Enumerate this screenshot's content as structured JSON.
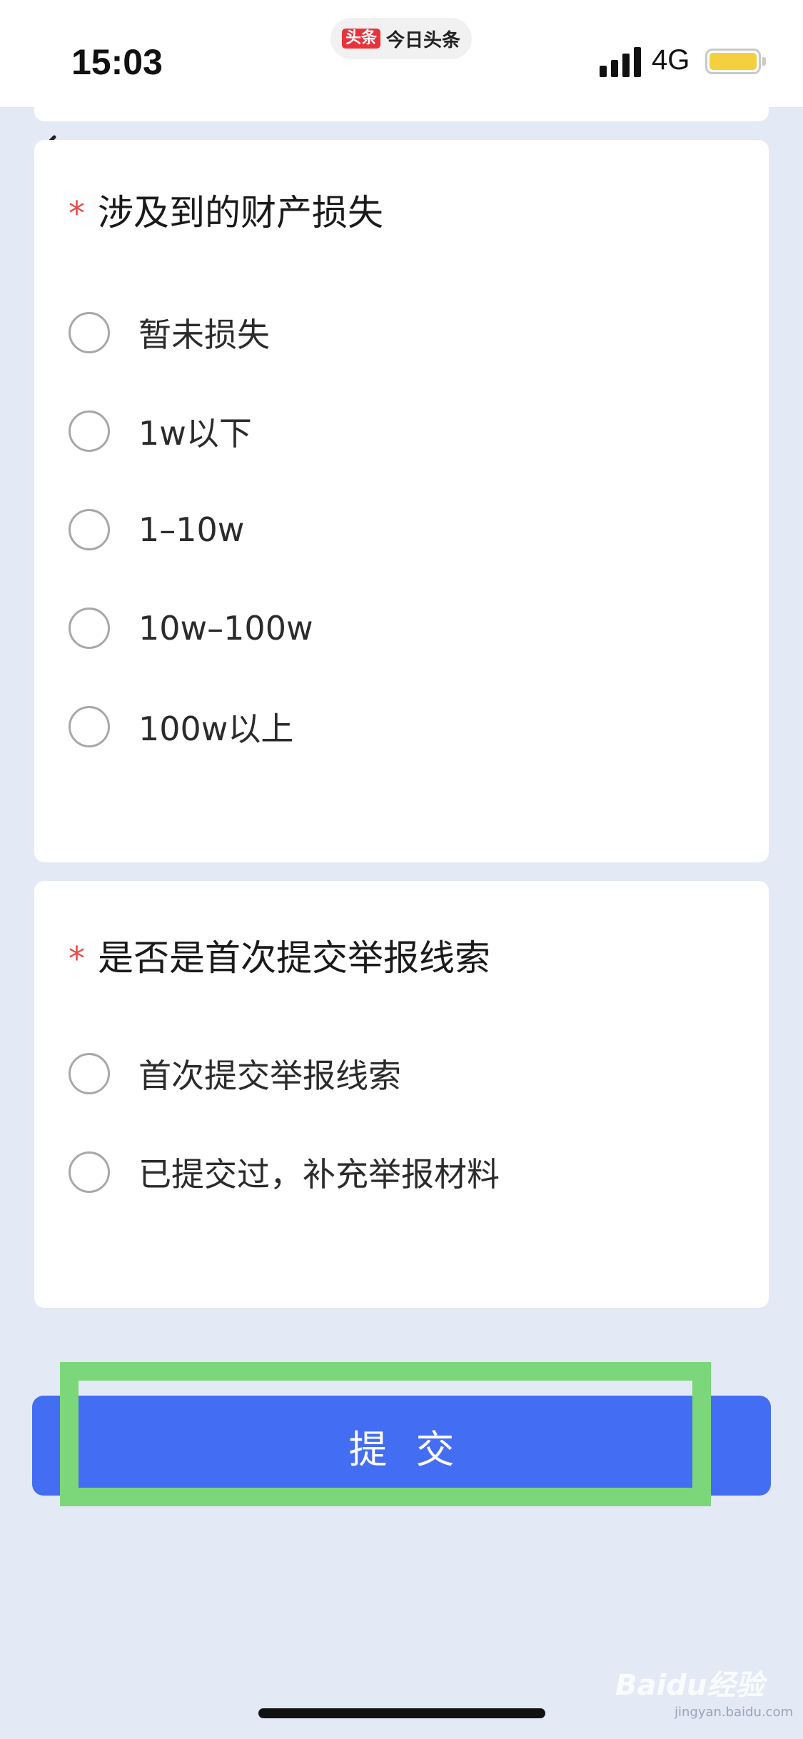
{
  "status_bar": {
    "time": "15:03",
    "app_name": "今日头条",
    "app_logo": "头条",
    "network": "4G",
    "signal_icon": "signal-bars-icon",
    "battery_icon": "battery-icon",
    "battery_color": "#f4d03f"
  },
  "nav": {
    "back_icon": "chevron-left-icon"
  },
  "questions": [
    {
      "required_mark": "*",
      "title": "涉及到的财产损失",
      "options": [
        "暂未损失",
        "1w以下",
        "1–10w",
        "10w–100w",
        "100w以上"
      ]
    },
    {
      "required_mark": "*",
      "title": "是否是首次提交举报线索",
      "options": [
        "首次提交举报线索",
        "已提交过，补充举报材料"
      ]
    }
  ],
  "submit": {
    "label": "提交",
    "color": "#436df2"
  },
  "highlight_color": "#7bd77a",
  "watermark": {
    "text": "Baidu经验",
    "sub": "jingyan.baidu.com"
  },
  "colors": {
    "background": "#e4e9f6",
    "required": "#e84b4b"
  }
}
